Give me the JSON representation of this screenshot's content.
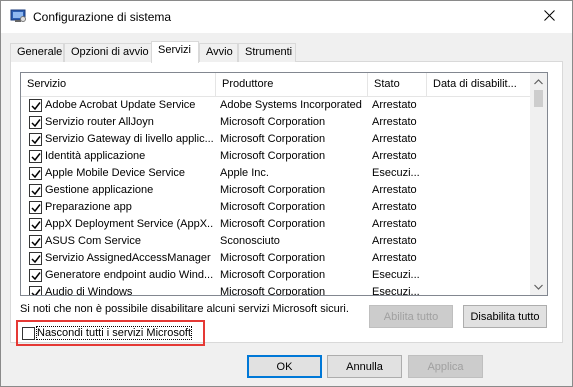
{
  "window": {
    "title": "Configurazione di sistema",
    "close_icon": "close-icon"
  },
  "tabs": [
    {
      "label": "Generale"
    },
    {
      "label": "Opzioni di avvio"
    },
    {
      "label": "Servizi",
      "active": true
    },
    {
      "label": "Avvio"
    },
    {
      "label": "Strumenti"
    }
  ],
  "list": {
    "columns": [
      "Servizio",
      "Produttore",
      "Stato",
      "Data di disabilit..."
    ],
    "rows": [
      {
        "name": "Adobe Acrobat Update Service",
        "vendor": "Adobe Systems Incorporated",
        "status": "Arrestato",
        "checked": true
      },
      {
        "name": "Servizio router AllJoyn",
        "vendor": "Microsoft Corporation",
        "status": "Arrestato",
        "checked": true
      },
      {
        "name": "Servizio Gateway di livello applic...",
        "vendor": "Microsoft Corporation",
        "status": "Arrestato",
        "checked": true
      },
      {
        "name": "Identità applicazione",
        "vendor": "Microsoft Corporation",
        "status": "Arrestato",
        "checked": true
      },
      {
        "name": "Apple Mobile Device Service",
        "vendor": "Apple Inc.",
        "status": "Esecuzi...",
        "checked": true
      },
      {
        "name": "Gestione applicazione",
        "vendor": "Microsoft Corporation",
        "status": "Arrestato",
        "checked": true
      },
      {
        "name": "Preparazione app",
        "vendor": "Microsoft Corporation",
        "status": "Arrestato",
        "checked": true
      },
      {
        "name": "AppX Deployment Service (AppX...",
        "vendor": "Microsoft Corporation",
        "status": "Arrestato",
        "checked": true
      },
      {
        "name": "ASUS Com Service",
        "vendor": "Sconosciuto",
        "status": "Arrestato",
        "checked": true
      },
      {
        "name": "Servizio AssignedAccessManager",
        "vendor": "Microsoft Corporation",
        "status": "Arrestato",
        "checked": true
      },
      {
        "name": "Generatore endpoint audio Wind...",
        "vendor": "Microsoft Corporation",
        "status": "Esecuzi...",
        "checked": true
      },
      {
        "name": "Audio di Windows",
        "vendor": "Microsoft Corporation",
        "status": "Esecuzi...",
        "checked": true
      }
    ]
  },
  "note": "Si noti che non è possibile disabilitare alcuni servizi Microsoft sicuri.",
  "buttons": {
    "enable_all": "Abilita tutto",
    "disable_all": "Disabilita tutto",
    "ok": "OK",
    "cancel": "Annulla",
    "apply": "Applica"
  },
  "hide_microsoft": {
    "label": "Nascondi tutti i servizi Microsoft",
    "checked": false
  }
}
